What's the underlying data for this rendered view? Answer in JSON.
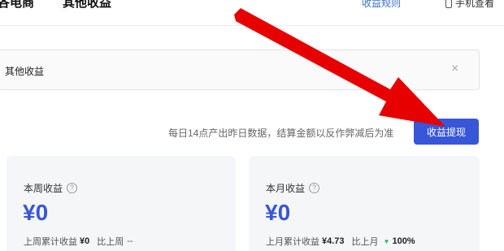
{
  "tabs": [
    "各电商",
    "其他收益"
  ],
  "top_links": {
    "rules": "收益规则",
    "phone": "手机查看"
  },
  "dropdown": {
    "text": "其他收益",
    "close": "×"
  },
  "notice": "每日14点产出昨日数据，结算金额以反作弊减后为准",
  "withdraw_button": "收益提现",
  "cards": [
    {
      "title": "本周收益",
      "amount": "¥0",
      "footer_label": "上周累计收益",
      "footer_value": "¥0",
      "compare_label": "比上周",
      "compare_value": "--"
    },
    {
      "title": "本月收益",
      "amount": "¥0",
      "footer_label": "上月累计收益",
      "footer_value": "¥4.73",
      "compare_label": "比上月",
      "compare_value": "100%"
    }
  ],
  "colors": {
    "primary": "#3856d8",
    "arrow": "#e60000",
    "down": "#20b26b"
  }
}
